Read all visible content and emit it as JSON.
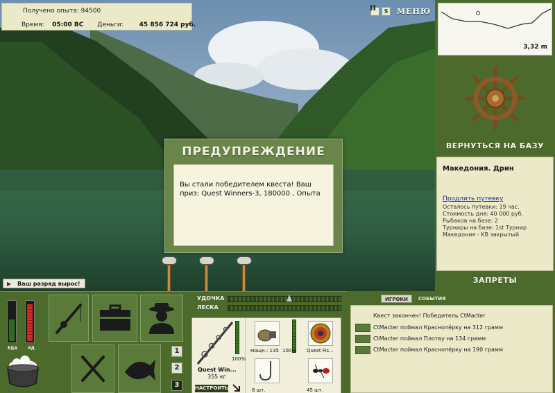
{
  "header": {
    "experience": "Получено опыта: 94500",
    "time_label": "Время:",
    "time_value": "05:00 ВС",
    "money_label": "Деньги:",
    "money_value": "45 856 724 руб.",
    "pause_icon": "pause-icon",
    "sound_label": "S",
    "menu_label": "МЕНЮ"
  },
  "dialog": {
    "title": "ПРЕДУПРЕЖДЕНИЕ",
    "message": "Вы стали победителем квеста! Ваш приз: Quest Winners-3, 180000 , Опыта"
  },
  "rank_notice": "Ваш разряд вырос!",
  "map": {
    "depth": "3,32 m"
  },
  "right_panel": {
    "return_label": "ВЕРНУТЬСЯ НА БАЗУ",
    "base_name": "Македония. Дрин",
    "extend_link": "Продлить путевку",
    "stats": [
      "Осталось путевки: 19 час.",
      "Стоимость дня: 40 000 руб.",
      "Рыбаков на базе: 2"
    ],
    "tournaments": "Турниры на базе: 1st Турнир Македония - KB закрытый",
    "bans_label": "ЗАПРЕТЫ"
  },
  "meters": {
    "food_label": "ЕДА",
    "poison_label": "ЯД",
    "food_level": 0.55,
    "poison_level": 0.95
  },
  "nav_numbers": [
    "1",
    "2",
    "3"
  ],
  "gear": {
    "rod_label": "УДОЧКА",
    "line_label": "ЛЕСКА",
    "rod_name": "Quest Win...",
    "rod_weight": "355 кг",
    "setup_label": "НАСТРОИТЬ",
    "rod_pct": "100%",
    "reel_label": "мощн.: 135",
    "reel_pct": "100%",
    "line_name": "Quest Fis...",
    "hook_count": "8 шт.",
    "bait_count": "45 шт."
  },
  "events": {
    "tab_players": "ИГРОКИ",
    "tab_events": "СОБЫТИЯ",
    "lines": [
      "Квест закончен! Победитель CtMacter",
      "CtMacter поймал Краснопёрку на 312 грамм",
      "CtMacter поймал Плотву на 134 грамм",
      "CtMacter поймал Краснопёрку на 190 грамм"
    ]
  },
  "colors": {
    "panel_green": "#4b6a2c",
    "panel_cream": "#ebe9c8",
    "dialog_green": "#6a8549"
  }
}
